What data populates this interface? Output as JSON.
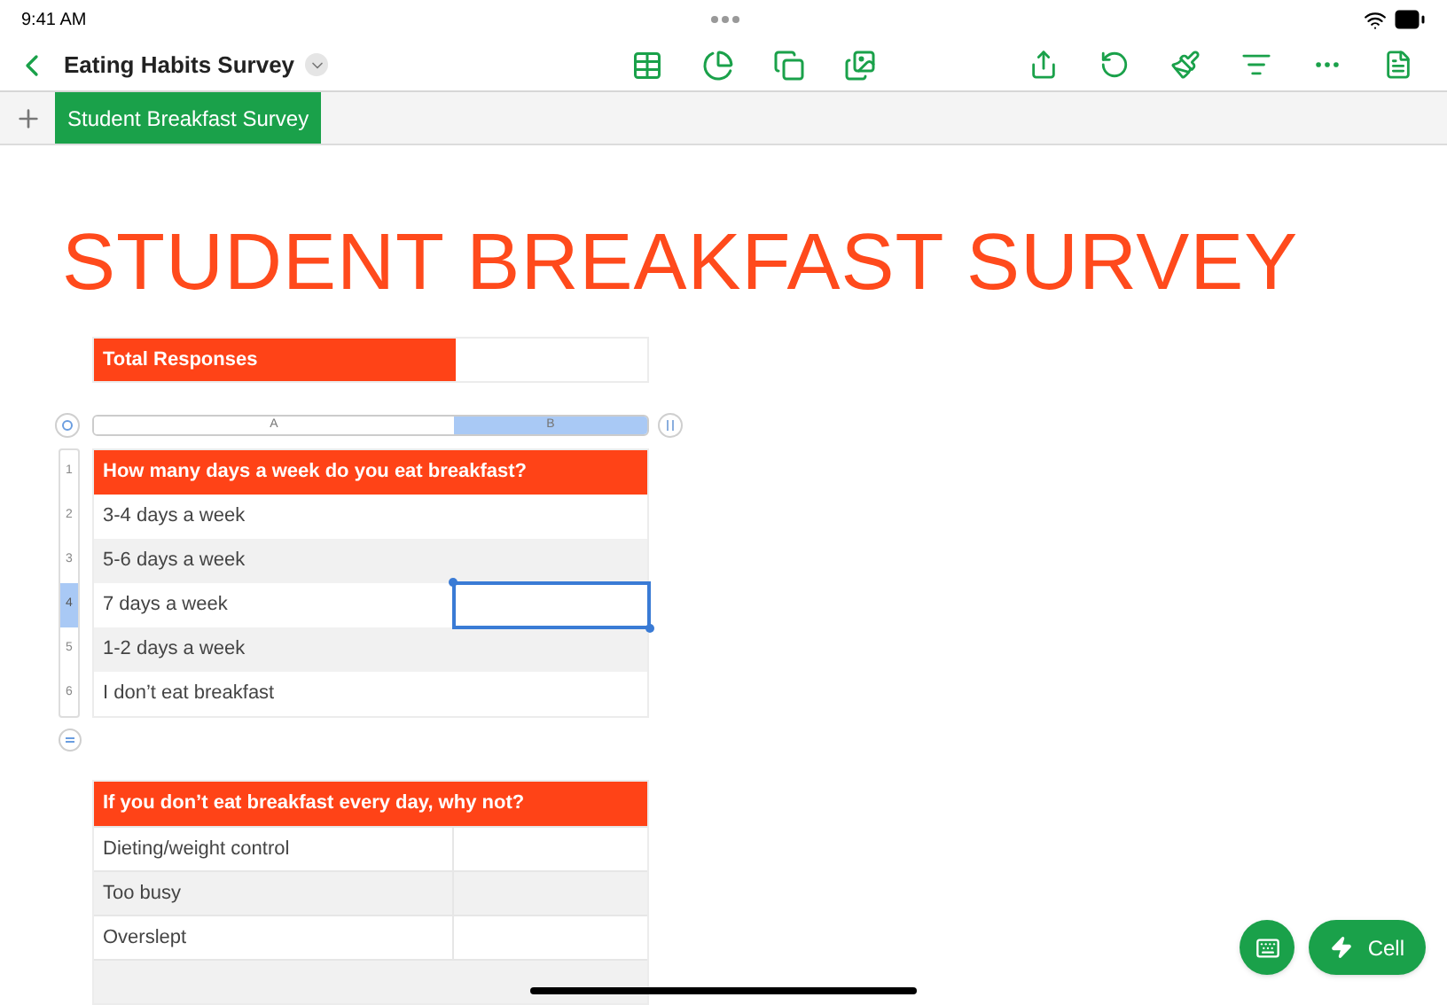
{
  "status_bar": {
    "time": "9:41 AM"
  },
  "toolbar": {
    "title": "Eating Habits Survey"
  },
  "sheet_tabs": [
    {
      "label": "Student Breakfast Survey",
      "selected": true
    }
  ],
  "title": "STUDENT BREAKFAST SURVEY",
  "summary_table": {
    "label": "Total Responses"
  },
  "table": {
    "columns": [
      {
        "label": "A",
        "selected": false
      },
      {
        "label": "B",
        "selected": true
      }
    ],
    "rows": [
      {
        "number": "1",
        "kind": "header",
        "cell": "How many days a week do you eat breakfast?",
        "selected": false
      },
      {
        "number": "2",
        "kind": "body",
        "cell": "3-4 days a week",
        "selected": false
      },
      {
        "number": "3",
        "kind": "body",
        "cell": "5-6 days a week",
        "selected": false
      },
      {
        "number": "4",
        "kind": "body",
        "cell": "7 days a week",
        "selected": true
      },
      {
        "number": "5",
        "kind": "body",
        "cell": "1-2 days a week",
        "selected": false
      },
      {
        "number": "6",
        "kind": "body",
        "cell": "I don’t eat breakfast",
        "selected": false
      }
    ]
  },
  "reasons_table": {
    "header": "If you don’t eat breakfast every day, why not?",
    "rows": [
      "Dieting/weight control",
      "Too busy",
      "Overslept"
    ]
  },
  "actions": [
    {
      "kind": "keyboard"
    },
    {
      "kind": "cell",
      "label": "Cell"
    }
  ]
}
